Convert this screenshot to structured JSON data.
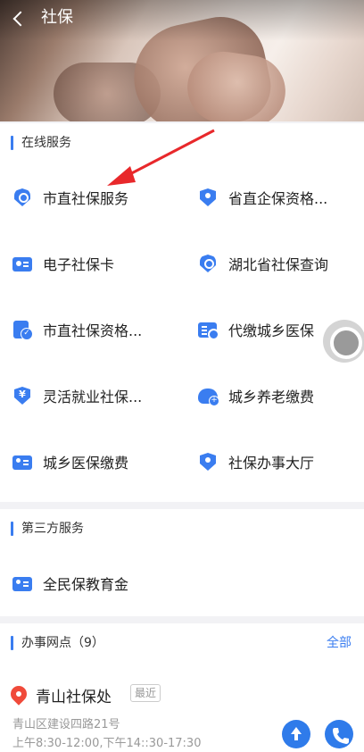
{
  "header": {
    "title": "社保"
  },
  "online": {
    "title": "在线服务",
    "items": [
      {
        "label": "市直社保服务",
        "icon": "shield-search-icon"
      },
      {
        "label": "省直企保资格...",
        "icon": "shield-person-icon"
      },
      {
        "label": "电子社保卡",
        "icon": "card-icon"
      },
      {
        "label": "湖北省社保查询",
        "icon": "shield-search-icon"
      },
      {
        "label": "市直社保资格...",
        "icon": "document-check-icon"
      },
      {
        "label": "代缴城乡医保",
        "icon": "list-card-icon"
      },
      {
        "label": "灵活就业社保...",
        "icon": "shield-yen-icon"
      },
      {
        "label": "城乡养老缴费",
        "icon": "cloud-plus-icon"
      },
      {
        "label": "城乡医保缴费",
        "icon": "id-card-icon"
      },
      {
        "label": "社保办事大厅",
        "icon": "shield-person-icon"
      }
    ]
  },
  "third": {
    "title": "第三方服务",
    "items": [
      {
        "label": "全民保教育金",
        "icon": "id-card-icon"
      }
    ]
  },
  "offices": {
    "title": "办事网点（9）",
    "all_label": "全部",
    "first": {
      "name": "青山社保处",
      "badge": "最近",
      "address": "青山区建设四路21号",
      "hours": "上午8:30-12:00,下午14::30-17:30"
    }
  },
  "colors": {
    "accent": "#3a7df0",
    "pin": "#f04a3a",
    "annotation_arrow": "#e8282b"
  }
}
